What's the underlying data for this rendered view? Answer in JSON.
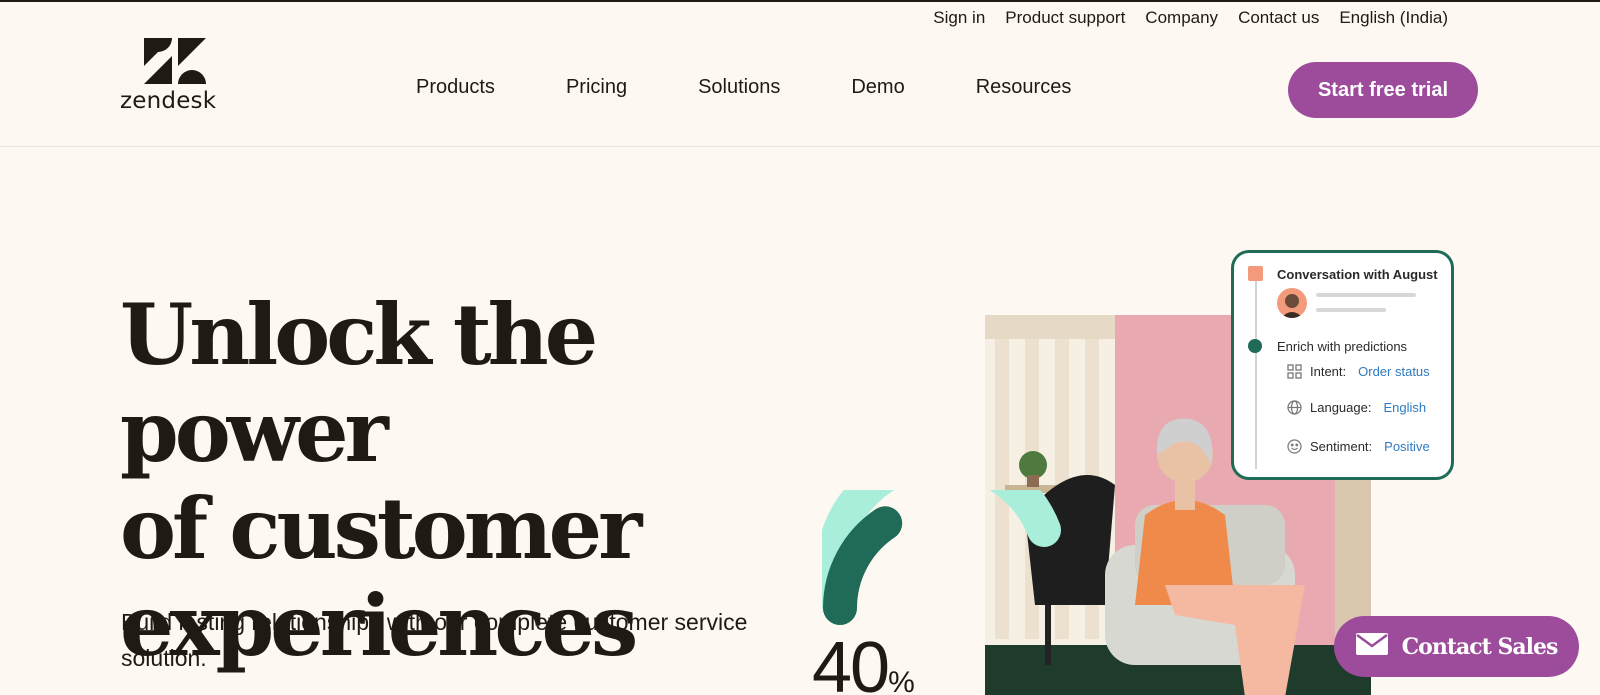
{
  "utility_nav": [
    {
      "label": "Sign in"
    },
    {
      "label": "Product support"
    },
    {
      "label": "Company"
    },
    {
      "label": "Contact us"
    },
    {
      "label": "English (India)"
    }
  ],
  "logo": {
    "wordmark": "zendesk",
    "icon": "zendesk-z-logo"
  },
  "main_nav": [
    {
      "label": "Products"
    },
    {
      "label": "Pricing"
    },
    {
      "label": "Solutions"
    },
    {
      "label": "Demo"
    },
    {
      "label": "Resources"
    }
  ],
  "cta": {
    "trial_label": "Start free trial"
  },
  "hero": {
    "title_line1": "Unlock the power",
    "title_line2": "of customer",
    "title_line3": "experiences",
    "subtitle": "Build lasting relationships with our complete customer service solution."
  },
  "stat": {
    "value": "40",
    "unit": "%",
    "gauge_fraction": 0.4
  },
  "card": {
    "title": "Conversation with August",
    "enrich_label": "Enrich with predictions",
    "rows": [
      {
        "label": "Intent:",
        "value": "Order status",
        "icon": "grid-icon"
      },
      {
        "label": "Language:",
        "value": "English",
        "icon": "globe-icon"
      },
      {
        "label": "Sentiment:",
        "value": "Positive",
        "icon": "smiley-icon"
      }
    ]
  },
  "contact_sales": {
    "label": "Contact Sales",
    "icon": "mail-icon"
  },
  "colors": {
    "background": "#fdf9f2",
    "brand_purple": "#9c4c9b",
    "dark_green": "#1f6b57",
    "mint": "#a8eedb",
    "text": "#1f1a14"
  }
}
